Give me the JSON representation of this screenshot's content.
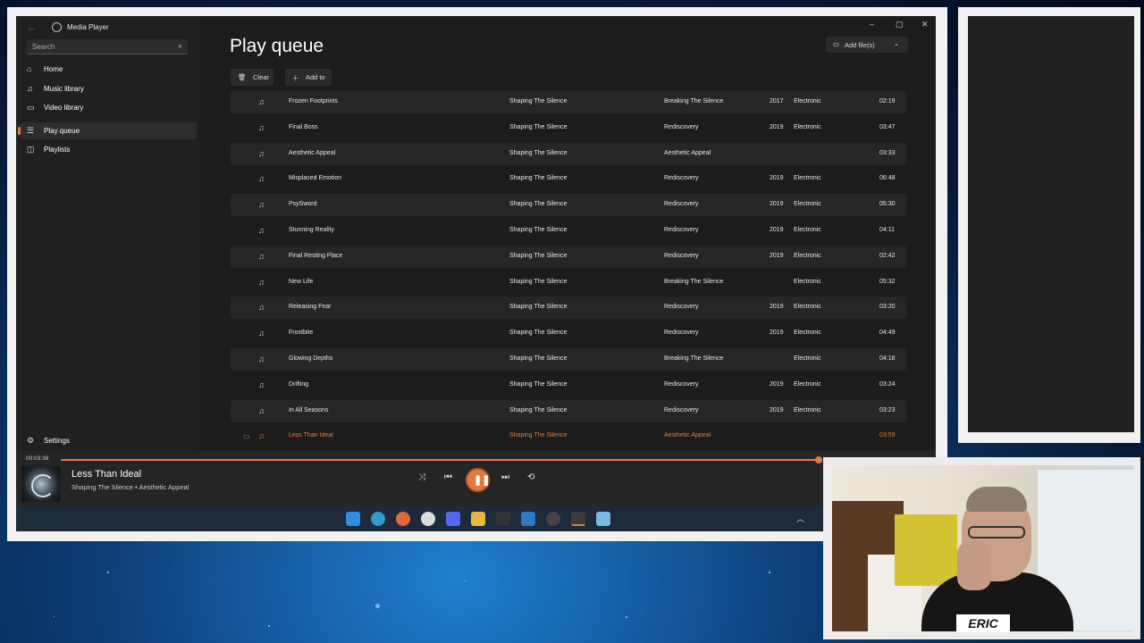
{
  "window": {
    "app_title": "Media Player"
  },
  "search": {
    "placeholder": "Search"
  },
  "sidebar": {
    "items": [
      {
        "label": "Home",
        "icon": "home-icon"
      },
      {
        "label": "Music library",
        "icon": "music-icon"
      },
      {
        "label": "Video library",
        "icon": "video-icon"
      },
      {
        "label": "Play queue",
        "icon": "queue-icon",
        "active": true
      },
      {
        "label": "Playlists",
        "icon": "playlist-icon"
      }
    ],
    "settings_label": "Settings"
  },
  "page": {
    "title": "Play queue",
    "clear_label": "Clear",
    "add_to_label": "Add to",
    "add_files_label": "Add file(s)"
  },
  "queue": [
    {
      "title": "Frozen Footprints",
      "artist": "Shaping The Silence",
      "album": "Breaking The Silence",
      "year": "2017",
      "genre": "Electronic",
      "duration": "02:19"
    },
    {
      "title": "Final Boss",
      "artist": "Shaping The Silence",
      "album": "Rediscovery",
      "year": "2019",
      "genre": "Electronic",
      "duration": "03:47"
    },
    {
      "title": "Aesthetic Appeal",
      "artist": "Shaping The Silence",
      "album": "Aesthetic Appeal",
      "year": "",
      "genre": "",
      "duration": "03:33"
    },
    {
      "title": "Misplaced Emotion",
      "artist": "Shaping The Silence",
      "album": "Rediscovery",
      "year": "2019",
      "genre": "Electronic",
      "duration": "06:48"
    },
    {
      "title": "PsySword",
      "artist": "Shaping The Silence",
      "album": "Rediscovery",
      "year": "2019",
      "genre": "Electronic",
      "duration": "05:30"
    },
    {
      "title": "Stunning Reality",
      "artist": "Shaping The Silence",
      "album": "Rediscovery",
      "year": "2019",
      "genre": "Electronic",
      "duration": "04:11"
    },
    {
      "title": "Final Resting Place",
      "artist": "Shaping The Silence",
      "album": "Rediscovery",
      "year": "2019",
      "genre": "Electronic",
      "duration": "02:42"
    },
    {
      "title": "New Life",
      "artist": "Shaping The Silence",
      "album": "Breaking The Silence",
      "year": "",
      "genre": "Electronic",
      "duration": "05:32"
    },
    {
      "title": "Releasing Fear",
      "artist": "Shaping The Silence",
      "album": "Rediscovery",
      "year": "2019",
      "genre": "Electronic",
      "duration": "03:20"
    },
    {
      "title": "Frostbite",
      "artist": "Shaping The Silence",
      "album": "Rediscovery",
      "year": "2019",
      "genre": "Electronic",
      "duration": "04:49"
    },
    {
      "title": "Glowing Depths",
      "artist": "Shaping The Silence",
      "album": "Breaking The Silence",
      "year": "",
      "genre": "Electronic",
      "duration": "04:18"
    },
    {
      "title": "Drifting",
      "artist": "Shaping The Silence",
      "album": "Rediscovery",
      "year": "2019",
      "genre": "Electronic",
      "duration": "03:24"
    },
    {
      "title": "In All Seasons",
      "artist": "Shaping The Silence",
      "album": "Rediscovery",
      "year": "2019",
      "genre": "Electronic",
      "duration": "03:23"
    },
    {
      "title": "Less Than Ideal",
      "artist": "Shaping The Silence",
      "album": "Aesthetic Appeal",
      "year": "",
      "genre": "",
      "duration": "03:59",
      "playing": true
    }
  ],
  "player": {
    "current_time": "00:03:38",
    "progress": 0.99,
    "track_title": "Less Than Ideal",
    "track_subtitle": "Shaping The Silence • Aesthetic Appeal",
    "state": "playing"
  },
  "webcam": {
    "name_label": "ERIC"
  },
  "colors": {
    "accent": "#e47b3d",
    "background": "#202020",
    "content": "#1c1c1c"
  }
}
